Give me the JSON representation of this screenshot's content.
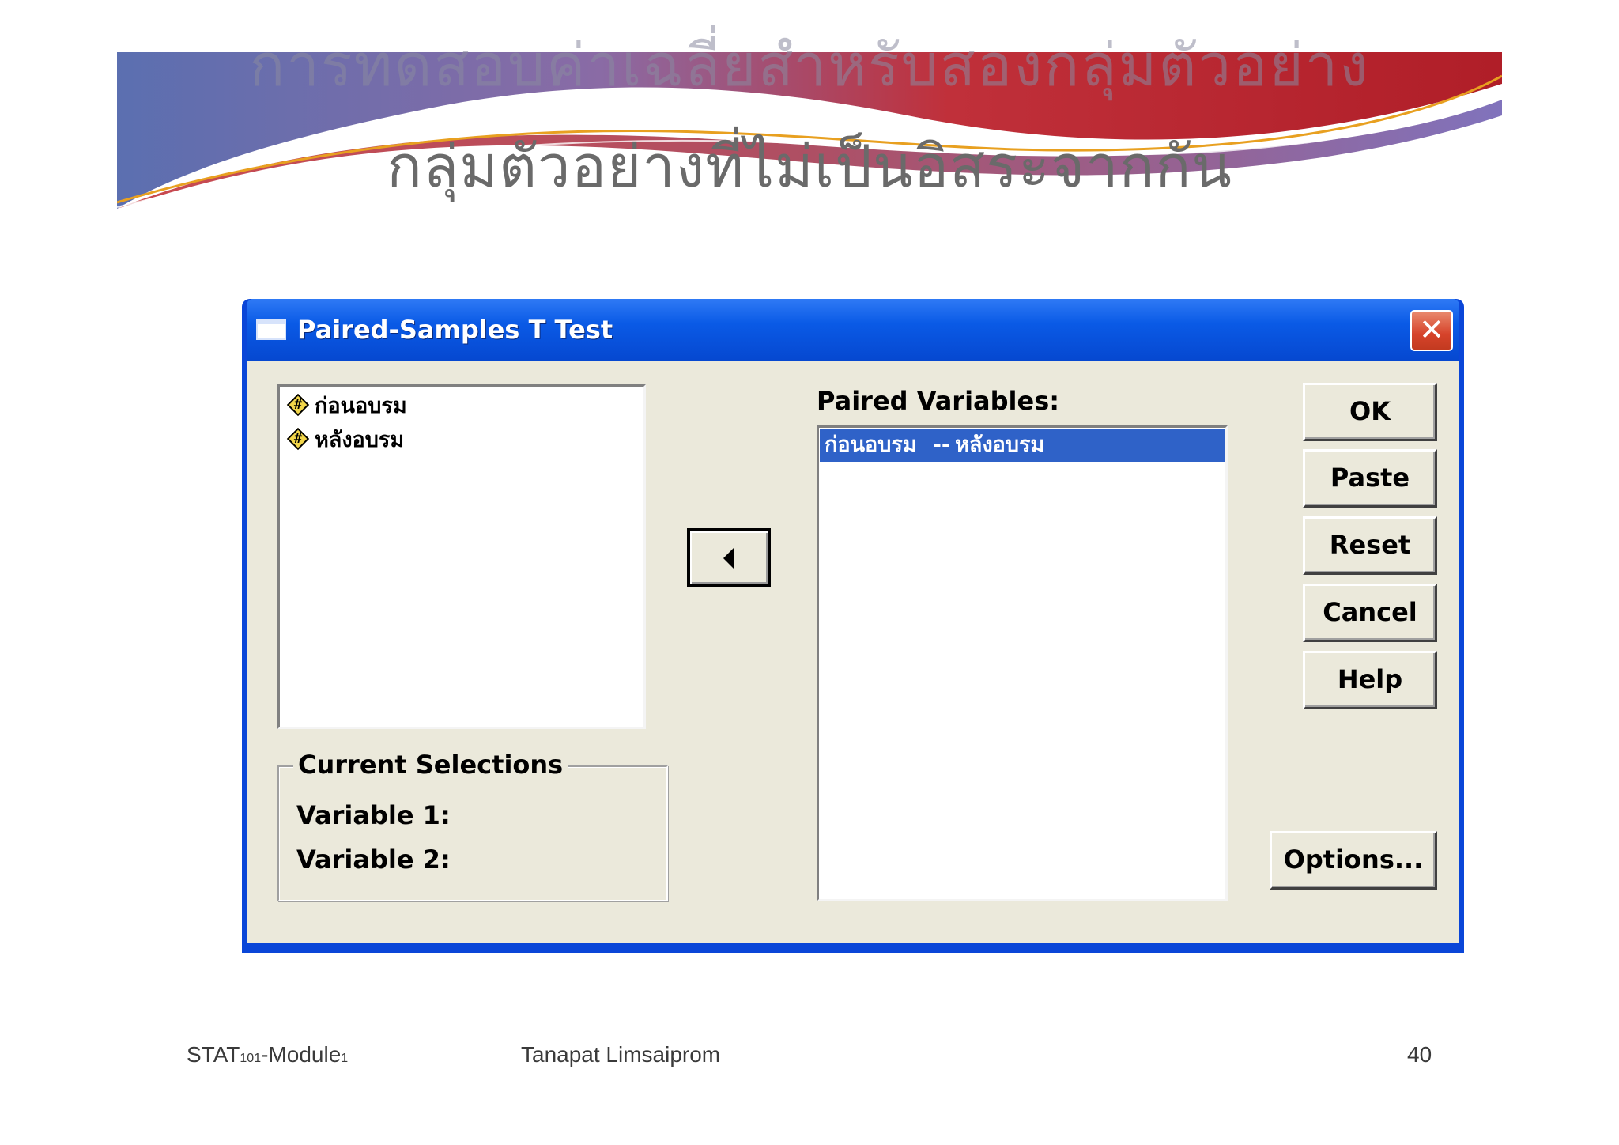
{
  "slide": {
    "title_line1": "การทดสอบค่าเฉลี่ยสำหรับสองกลุ่มตัวอย่าง",
    "title_line2": "กลุ่มตัวอย่างที่ไม่เป็นอิสระจากกัน",
    "footer": {
      "course_prefix": "STAT",
      "course_num": "101",
      "course_mid": "-Module",
      "course_num2": "1",
      "author": "Tanapat Limsaiprom",
      "page": "40"
    }
  },
  "dialog": {
    "title": "Paired-Samples T Test",
    "close_glyph": "✕",
    "source_variables": [
      {
        "label": "ก่อนอบรม",
        "icon": "scale-variable-icon",
        "icon_glyph": "#"
      },
      {
        "label": "หลังอบรม",
        "icon": "scale-variable-icon",
        "icon_glyph": "#"
      }
    ],
    "paired_label": "Paired Variables:",
    "pairs": [
      {
        "var1": "ก่อนอบรม",
        "separator": "--",
        "var2": "หลังอบรม",
        "selected": true
      }
    ],
    "current_selections": {
      "legend": "Current Selections",
      "variable1_label": "Variable 1:",
      "variable2_label": "Variable 2:"
    },
    "buttons": {
      "ok": "OK",
      "paste": "Paste",
      "reset": "Reset",
      "cancel": "Cancel",
      "help": "Help",
      "options": "Options..."
    }
  }
}
